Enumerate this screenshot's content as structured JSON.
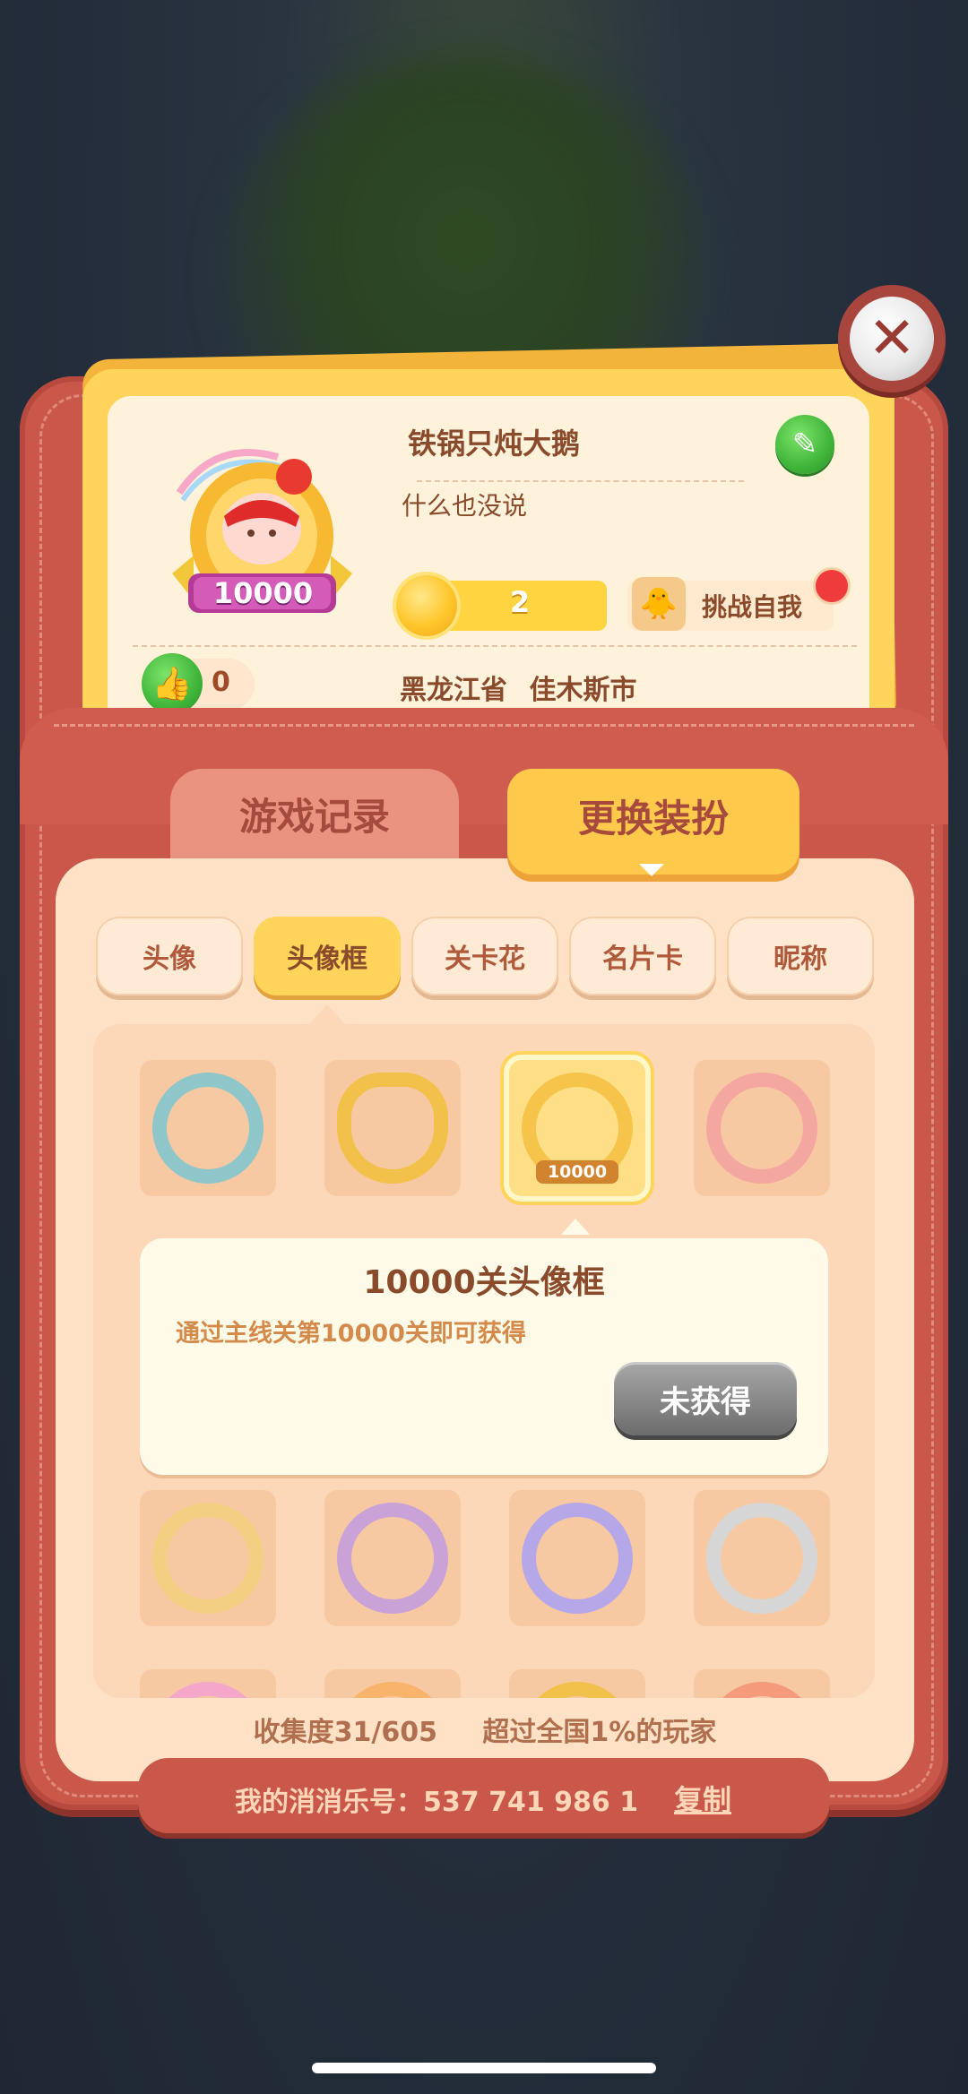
{
  "profile": {
    "nickname": "铁锅只炖大鹅",
    "signature": "什么也没说",
    "avatar_badge": "10000",
    "stars": "2",
    "challenge_label": "挑战自我",
    "likes": "0",
    "province": "黑龙江省",
    "city": "佳木斯市"
  },
  "main_tabs": {
    "records": "游戏记录",
    "outfit": "更换装扮"
  },
  "sub_tabs": [
    "头像",
    "头像框",
    "关卡花",
    "名片卡",
    "昵称"
  ],
  "frames": {
    "selected_badge": "10000",
    "ring_colors": [
      "#8fc6c9",
      "#f2c14a",
      "#f6c34b",
      "#f4a7a0",
      "#f3cf84",
      "#c9a2d8",
      "#b6a8e8",
      "#d6d6d6"
    ]
  },
  "tooltip": {
    "title": "10000关头像框",
    "description": "通过主线关第10000关即可获得",
    "button_label": "未获得"
  },
  "stats": {
    "collection": "收集度31/605",
    "rank": "超过全国1%的玩家"
  },
  "account": {
    "label": "我的消消乐号：537 741 986 1",
    "copy_label": "复制"
  },
  "colors": {
    "wallet": "#c9574a",
    "panel": "#ffe2c6",
    "accent_yellow": "#ffd45a",
    "text_brown": "#8a4a2c"
  }
}
